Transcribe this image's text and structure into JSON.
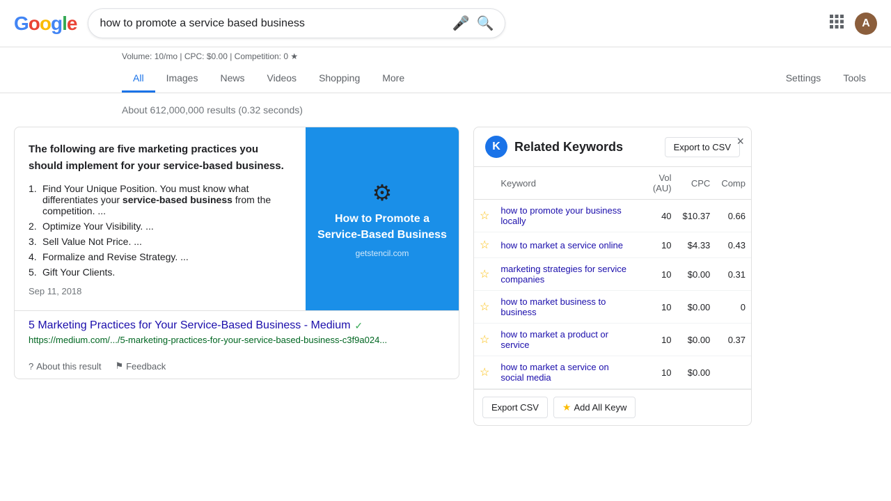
{
  "header": {
    "logo_letters": [
      "G",
      "o",
      "o",
      "g",
      "l",
      "e"
    ],
    "search_value": "how to promote a service based business",
    "mic_icon": "🎤",
    "search_btn_icon": "🔍",
    "apps_icon": "⋮⋮⋮",
    "avatar_letter": "A"
  },
  "volume_bar": {
    "text": "Volume: 10/mo | CPC: $0.00 | Competition: 0 ★"
  },
  "nav": {
    "tabs": [
      {
        "label": "All",
        "active": true
      },
      {
        "label": "Images",
        "active": false
      },
      {
        "label": "News",
        "active": false
      },
      {
        "label": "Videos",
        "active": false
      },
      {
        "label": "Shopping",
        "active": false
      },
      {
        "label": "More",
        "active": false
      }
    ],
    "right_tabs": [
      {
        "label": "Settings"
      },
      {
        "label": "Tools"
      }
    ]
  },
  "results_info": "About 612,000,000 results (0.32 seconds)",
  "result_card": {
    "intro_text": "The following are five marketing practices you should implement for your service-based business.",
    "list_items": [
      {
        "num": "1",
        "text": "Find Your Unique Position. You must know what differentiates your ",
        "bold": "service-based business",
        "rest": " from the competition. ..."
      },
      {
        "num": "2",
        "text": "Optimize Your Visibility. ..."
      },
      {
        "num": "3",
        "text": "Sell Value Not Price. ..."
      },
      {
        "num": "4",
        "text": "Formalize and Revise Strategy. ..."
      },
      {
        "num": "5",
        "text": "Gift Your Clients."
      }
    ],
    "date": "Sep 11, 2018",
    "image_title": "How to Promote a Service-Based Business",
    "image_domain": "getstencil.com",
    "link_text": "5 Marketing Practices for Your Service-Based Business - Medium",
    "link_url": "https://medium.com/.../5-marketing-practices-for-your-service-based-business-c3f9a024...",
    "about_result": "About this result",
    "feedback": "Feedback"
  },
  "related_keywords": {
    "title": "Related Keywords",
    "k_letter": "K",
    "export_btn": "Export to CSV",
    "close_icon": "×",
    "col_keyword": "Keyword",
    "col_vol": "Vol (AU)",
    "col_cpc": "CPC",
    "col_comp": "Comp",
    "rows": [
      {
        "keyword": "how to promote your business locally",
        "vol": 40,
        "cpc": "$10.37",
        "comp": "0.66",
        "star": false
      },
      {
        "keyword": "how to market a service online",
        "vol": 10,
        "cpc": "$4.33",
        "comp": "0.43",
        "star": false
      },
      {
        "keyword": "marketing strategies for service companies",
        "vol": 10,
        "cpc": "$0.00",
        "comp": "0.31",
        "star": false
      },
      {
        "keyword": "how to market business to business",
        "vol": 10,
        "cpc": "$0.00",
        "comp": "0",
        "star": false
      },
      {
        "keyword": "how to market a product or service",
        "vol": 10,
        "cpc": "$0.00",
        "comp": "0.37",
        "star": false
      },
      {
        "keyword": "how to market a service on social media",
        "vol": 10,
        "cpc": "$0.00",
        "comp": "",
        "star": false
      }
    ],
    "footer_export": "Export CSV",
    "footer_add_all": "Add All Keyw"
  }
}
